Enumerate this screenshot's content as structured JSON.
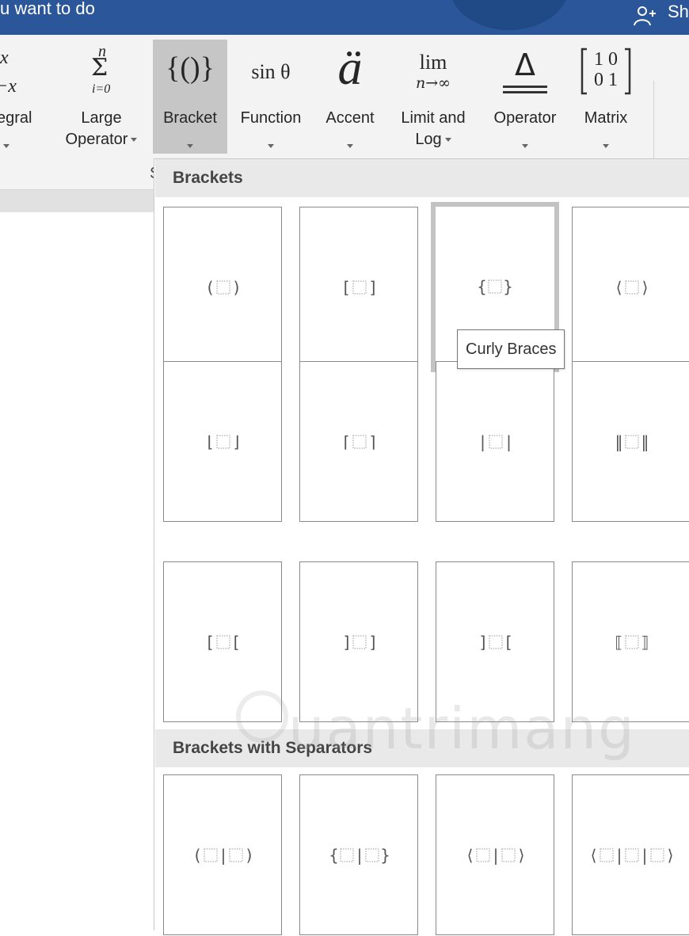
{
  "topbar": {
    "tell_me_text": "u want to do",
    "share_label": "Sh",
    "colors": {
      "bar": "#2b579a",
      "text": "#ffffff"
    }
  },
  "ribbon": {
    "buttons": [
      {
        "id": "integral",
        "label": "egral",
        "glyph": "integral-icon"
      },
      {
        "id": "large-operator",
        "label": "Large\nOperator",
        "glyph": "sum-icon"
      },
      {
        "id": "bracket",
        "label": "Bracket",
        "glyph": "bracket-icon",
        "selected": true
      },
      {
        "id": "function",
        "label": "Function",
        "glyph": "sin-theta-icon"
      },
      {
        "id": "accent",
        "label": "Accent",
        "glyph": "accent-a-icon"
      },
      {
        "id": "limit-log",
        "label": "Limit and\nLog",
        "glyph": "limit-icon"
      },
      {
        "id": "operator",
        "label": "Operator",
        "glyph": "delta-operator-icon"
      },
      {
        "id": "matrix",
        "label": "Matrix",
        "glyph": "matrix-icon"
      }
    ],
    "glyph_text": {
      "integral_top": "x",
      "integral_bottom": "−x",
      "sum_top": "n",
      "sum_symbol": "Σ",
      "sum_bottom": "i=0",
      "bracket": "{()}",
      "function": "sin θ",
      "accent": "ä",
      "limit_top": "lim",
      "limit_bottom": "n→∞",
      "operator": "Δ",
      "matrix_row1": "1 0",
      "matrix_row2": "0 1"
    },
    "group_label": "S"
  },
  "gallery": {
    "section_brackets": "Brackets",
    "section_separators": "Brackets with Separators",
    "tiles": [
      {
        "name": "parentheses",
        "left": "(",
        "right": ")"
      },
      {
        "name": "square-brackets",
        "left": "[",
        "right": "]"
      },
      {
        "name": "curly-braces",
        "left": "{",
        "right": "}"
      },
      {
        "name": "angle-brackets",
        "left": "⟨",
        "right": "⟩"
      },
      {
        "name": "floor",
        "left": "⌊",
        "right": "⌋"
      },
      {
        "name": "ceiling",
        "left": "⌈",
        "right": "⌉"
      },
      {
        "name": "single-bars",
        "left": "|",
        "right": "|"
      },
      {
        "name": "double-bars",
        "left": "‖",
        "right": "‖"
      },
      {
        "name": "square-open-left",
        "left": "[",
        "right": "["
      },
      {
        "name": "square-open-right",
        "left": "]",
        "right": "]"
      },
      {
        "name": "square-reversed",
        "left": "]",
        "right": "["
      },
      {
        "name": "double-square",
        "left": "⟦",
        "right": "⟧"
      }
    ],
    "separator_tiles": [
      {
        "name": "parentheses-separator",
        "left": "(",
        "mid": "|",
        "right": ")",
        "boxes": 2
      },
      {
        "name": "curly-braces-separator",
        "left": "{",
        "mid": "|",
        "right": "}",
        "boxes": 2
      },
      {
        "name": "angle-brackets-separator",
        "left": "⟨",
        "mid": "|",
        "right": "⟩",
        "boxes": 2
      },
      {
        "name": "angle-brackets-three-separator",
        "left": "⟨",
        "mid": "|",
        "right": "⟩",
        "boxes": 3
      }
    ],
    "highlighted_tile": "curly-braces",
    "tooltip": "Curly Braces"
  },
  "watermark": {
    "text": "uantrimang"
  }
}
